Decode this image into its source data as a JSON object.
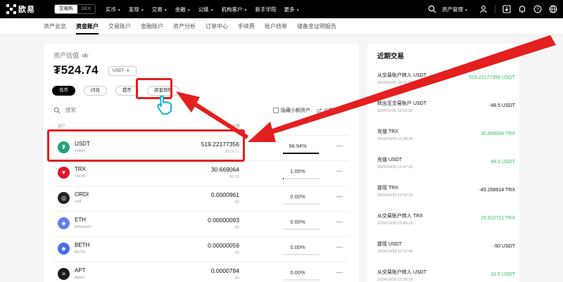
{
  "topbar": {
    "logo_text": "欧易",
    "switch": [
      "交易所",
      "DEX"
    ],
    "nav": [
      "买币",
      "发现",
      "交易",
      "金融",
      "公链",
      "机构客户",
      "新手学院",
      "更多"
    ],
    "asset_mgmt": "资产管理"
  },
  "subtabs": [
    "资产总览",
    "资金账户",
    "交易账户",
    "金融账户",
    "资产分析",
    "订单中心",
    "手续费",
    "账户结单",
    "储备金证明报告"
  ],
  "summary": {
    "label": "资产估值",
    "balance": "₮524.74",
    "currency": "USDT",
    "buttons": [
      "充币",
      "闪兑",
      "提币",
      "资金划转"
    ]
  },
  "search": {
    "placeholder": "搜索"
  },
  "options": {
    "hide_small": "隐藏小额资产",
    "small_convert": "小额兑换"
  },
  "table": {
    "headers": [
      "资产",
      "金额",
      "比例"
    ],
    "rows": [
      {
        "symbol": "USDT",
        "name": "Tether",
        "amount": "519.22177356",
        "fiat": "₮519.22",
        "pct": "98.94%",
        "pct_value": 98.94,
        "icon_color": "#26a17b",
        "icon_glyph": "₮",
        "more": "—"
      },
      {
        "symbol": "TRX",
        "name": "TRON",
        "amount": "30.669064",
        "fiat": "₮5.52",
        "pct": "1.05%",
        "pct_value": 1.05,
        "icon_color": "#e0162b",
        "icon_glyph": "▼",
        "more": "—"
      },
      {
        "symbol": "ORDI",
        "name": "ordi",
        "amount": "0.0000961",
        "fiat": "₮0",
        "pct": "0.00%",
        "pct_value": 0,
        "icon_color": "#222222",
        "icon_glyph": "◎",
        "more": "—"
      },
      {
        "symbol": "ETH",
        "name": "Ethereum",
        "amount": "0.00000093",
        "fiat": "₮0",
        "pct": "0.00%",
        "pct_value": 0,
        "icon_color": "#627eea",
        "icon_glyph": "◆",
        "more": "—"
      },
      {
        "symbol": "BETH",
        "name": "BETH",
        "amount": "0.00000059",
        "fiat": "₮0",
        "pct": "0.00%",
        "pct_value": 0,
        "icon_color": "#4a6cf0",
        "icon_glyph": "◆",
        "more": "—"
      },
      {
        "symbol": "APT",
        "name": "Aptos",
        "amount": "0.0000784",
        "fiat": "₮0",
        "pct": "0.00%",
        "pct_value": 0,
        "icon_color": "#1a1a1a",
        "icon_glyph": "≡",
        "more": "—"
      }
    ]
  },
  "side": {
    "title": "近期交易",
    "items": [
      {
        "title": "从交易账户转入 USDT",
        "time": "2024/11/06 16:22:20",
        "amount": "519.22177356 USDT",
        "positive": true
      },
      {
        "title": "转出至交易账户 USDT",
        "time": "2024/11/06 16:18:32",
        "amount": "-48.5 USDT",
        "positive": false
      },
      {
        "title": "充值 TRX",
        "time": "2024/10/30 12:48:20",
        "amount": "30.669064 TRX",
        "positive": true
      },
      {
        "title": "充值 USDT",
        "time": "2024/10/30 12:47:32",
        "amount": "48.5 USDT",
        "positive": true
      },
      {
        "title": "提现 TRX",
        "time": "2024/10/30 12:43:16",
        "amount": "-45.268914 TRX",
        "positive": false
      },
      {
        "title": "从交易账户转入 TRX",
        "time": "2024/10/30 12:40:23",
        "amount": "29.922721 TRX",
        "positive": true
      },
      {
        "title": "提现 USDT",
        "time": "2024/10/30 12:37:46",
        "amount": "-50 USDT",
        "positive": false
      },
      {
        "title": "从交易账户转入 USDT",
        "time": "2024/10/30 12:35:10",
        "amount": "31.5 USDT",
        "positive": true
      }
    ]
  },
  "colors": {
    "highlight": "#e41f1f",
    "positive": "#2fbf5f",
    "cursor": "#00b3c7"
  }
}
